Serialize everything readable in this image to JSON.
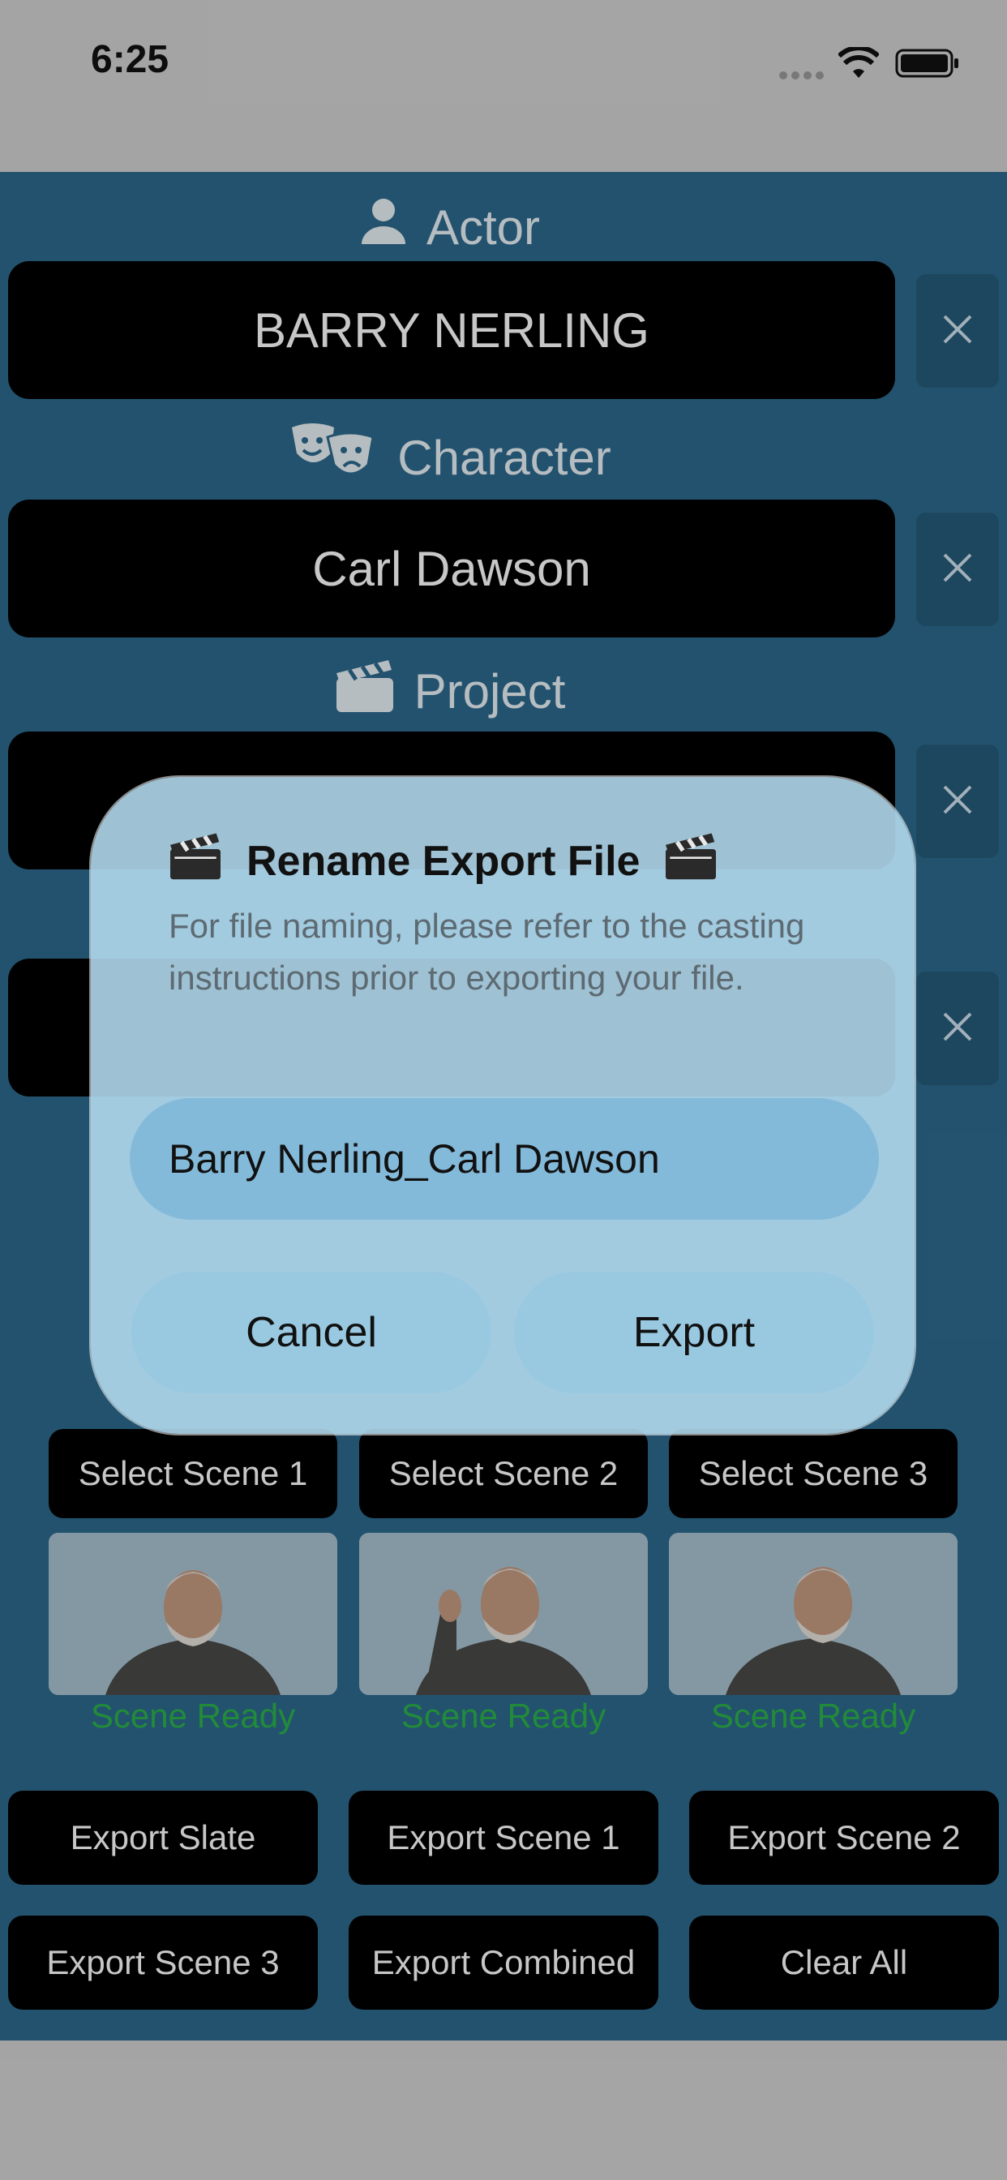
{
  "status_bar": {
    "time": "6:25"
  },
  "form": {
    "actor_label": "Actor",
    "actor_value": "BARRY NERLING",
    "character_label": "Character",
    "character_value": "Carl Dawson",
    "project_label": "Project"
  },
  "scenes": [
    {
      "select_label": "Select Scene 1",
      "status": "Scene Ready"
    },
    {
      "select_label": "Select Scene 2",
      "status": "Scene Ready"
    },
    {
      "select_label": "Select Scene 3",
      "status": "Scene Ready"
    }
  ],
  "actions": {
    "export_slate": "Export Slate",
    "export_scene_1": "Export Scene 1",
    "export_scene_2": "Export Scene 2",
    "export_scene_3": "Export Scene 3",
    "export_combined": "Export Combined",
    "clear_all": "Clear All"
  },
  "dialog": {
    "title": "Rename Export File",
    "message": "For file naming, please refer to the casting instructions prior to exporting your file.",
    "filename_value": "Barry Nerling_Carl Dawson",
    "cancel_label": "Cancel",
    "export_label": "Export"
  },
  "colors": {
    "background": "#2e6a8e",
    "field": "#000000",
    "clear_button": "#265b7a",
    "ready_text": "#2bb34a",
    "dialog": "#b4dcf0"
  },
  "icons": [
    "person-icon",
    "theater-masks-icon",
    "clapperboard-icon",
    "close-icon",
    "wifi-icon",
    "battery-icon",
    "signal-icon"
  ]
}
